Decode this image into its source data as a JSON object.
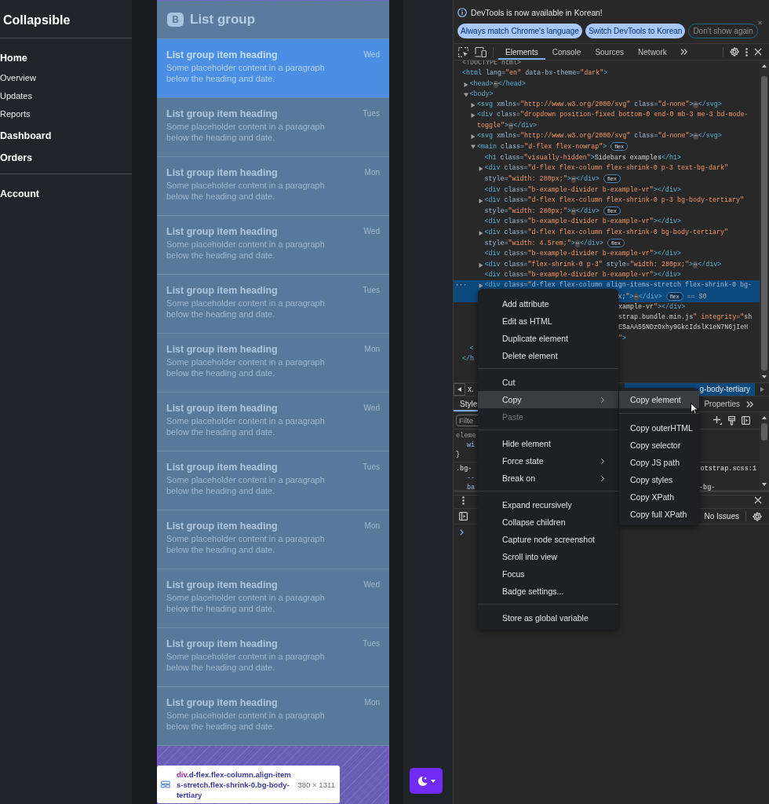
{
  "sidebar": {
    "title": "Collapsible",
    "sections": [
      {
        "label": "Home",
        "children": [
          {
            "label": "Overview"
          },
          {
            "label": "Updates"
          },
          {
            "label": "Reports"
          }
        ]
      },
      {
        "label": "Dashboard"
      },
      {
        "label": "Orders"
      }
    ],
    "footer": "Account"
  },
  "list_group": {
    "logo": "B",
    "title": "List group",
    "items": [
      {
        "heading": "List group item heading",
        "date": "Wed",
        "body": "Some placeholder content in a paragraph below the heading and date.",
        "selected": true
      },
      {
        "heading": "List group item heading",
        "date": "Tues",
        "body": "Some placeholder content in a paragraph below the heading and date.",
        "selected": false
      },
      {
        "heading": "List group item heading",
        "date": "Mon",
        "body": "Some placeholder content in a paragraph below the heading and date.",
        "selected": false
      },
      {
        "heading": "List group item heading",
        "date": "Wed",
        "body": "Some placeholder content in a paragraph below the heading and date.",
        "selected": false
      },
      {
        "heading": "List group item heading",
        "date": "Tues",
        "body": "Some placeholder content in a paragraph below the heading and date.",
        "selected": false
      },
      {
        "heading": "List group item heading",
        "date": "Mon",
        "body": "Some placeholder content in a paragraph below the heading and date.",
        "selected": false
      },
      {
        "heading": "List group item heading",
        "date": "Wed",
        "body": "Some placeholder content in a paragraph below the heading and date.",
        "selected": false
      },
      {
        "heading": "List group item heading",
        "date": "Tues",
        "body": "Some placeholder content in a paragraph below the heading and date.",
        "selected": false
      },
      {
        "heading": "List group item heading",
        "date": "Mon",
        "body": "Some placeholder content in a paragraph below the heading and date.",
        "selected": false
      },
      {
        "heading": "List group item heading",
        "date": "Wed",
        "body": "Some placeholder content in a paragraph below the heading and date.",
        "selected": false
      },
      {
        "heading": "List group item heading",
        "date": "Tues",
        "body": "Some placeholder content in a paragraph below the heading and date.",
        "selected": false
      },
      {
        "heading": "List group item heading",
        "date": "Mon",
        "body": "Some placeholder content in a paragraph below the heading and date.",
        "selected": false
      }
    ]
  },
  "inspect_tooltip": {
    "tag": "div",
    "classes": ".d-flex.flex-column.align-items-stretch.flex-shrink-0.bg-body-tertiary",
    "size": "380 × 1311"
  },
  "devtools": {
    "infobar": {
      "message": "DevTools is now available in Korean!",
      "buttons": [
        {
          "label": "Always match Chrome's language",
          "kind": "filled"
        },
        {
          "label": "Switch DevTools to Korean",
          "kind": "filled"
        },
        {
          "label": "Don't show again",
          "kind": "outlined"
        }
      ]
    },
    "tabs": [
      {
        "label": "Elements",
        "selected": true
      },
      {
        "label": "Console",
        "selected": false
      },
      {
        "label": "Sources",
        "selected": false
      },
      {
        "label": "Network",
        "selected": false
      }
    ],
    "tree": [
      {
        "text": "<!DOCTYPE html>",
        "kind": "doctype"
      },
      {
        "text": "<html lang=\"en\" data-bs-theme=\"dark\">",
        "kind": "element",
        "selected": false,
        "close": "</h",
        "children": [
          {
            "text": "<head>⋯</head>",
            "kind": "element",
            "selected": false,
            "expanded": false
          },
          {
            "text": "<body>",
            "kind": "element",
            "selected": false,
            "expanded": true,
            "close": "<",
            "children": [
              {
                "text": "<svg xmlns=\"http://www.w3.org/2000/svg\" class=\"d-none\">⋯</svg>",
                "kind": "element",
                "selected": false,
                "expanded": false
              },
              {
                "text": "<div class=\"dropdown position-fixed bottom-0 end-0 mb-3 me-3 bd-mode-toggle\">⋯</div>",
                "kind": "element",
                "selected": false,
                "expanded": false
              },
              {
                "text": "<svg xmlns=\"http://www.w3.org/2000/svg\" class=\"d-none\">⋯</svg>",
                "kind": "element",
                "selected": false,
                "expanded": false
              },
              {
                "text": "<main class=\"d-flex flex-nowrap\">",
                "kind": "element",
                "selected": false,
                "expanded": true,
                "badge": "flex",
                "children": [
                  {
                    "text": "<h1 class=\"visually-hidden\">Sidebars examples</h1>",
                    "kind": "element",
                    "selected": false
                  },
                  {
                    "text": "<div class=\"d-flex flex-column flex-shrink-0 p-3 text-bg-dark\" style=\"width: 280px;\">⋯</div>",
                    "kind": "element",
                    "selected": false,
                    "expanded": false,
                    "badge": "flex"
                  },
                  {
                    "text": "<div class=\"b-example-divider b-example-vr\"></div>",
                    "kind": "element",
                    "selected": false
                  },
                  {
                    "text": "<div class=\"d-flex flex-column flex-shrink-0 p-3 bg-body-tertiary\" style=\"width: 280px;\">⋯</div>",
                    "kind": "element",
                    "selected": false,
                    "expanded": false,
                    "badge": "flex"
                  },
                  {
                    "text": "<div class=\"b-example-divider b-example-vr\"></div>",
                    "kind": "element",
                    "selected": false
                  },
                  {
                    "text": "<div class=\"d-flex flex-column flex-shrink-0 bg-body-tertiary\" style=\"width: 4.5rem;\">⋯</div>",
                    "kind": "element",
                    "selected": false,
                    "expanded": false,
                    "badge": "flex"
                  },
                  {
                    "text": "<div class=\"b-example-divider b-example-vr\"></div>",
                    "kind": "element",
                    "selected": false
                  },
                  {
                    "text": "<div class=\"flex-shrink-0 p-3\" style=\"width: 280px;\">⋯</div>",
                    "kind": "element",
                    "selected": false,
                    "expanded": false
                  },
                  {
                    "text": "<div class=\"b-example-divider b-example-vr\"></div>",
                    "kind": "element",
                    "selected": false
                  },
                  {
                    "text": "<div class=\"d-flex flex-column align-items-stretch flex-shrink-0 bg-",
                    "continuation": "x;\">⋯</div>",
                    "gutter": "···",
                    "kind": "element",
                    "selected": true,
                    "expanded": false,
                    "badge": "flex",
                    "marker": "== $0"
                  },
                  {
                    "text": "xample-vr\"></div>",
                    "kind": "fragment"
                  },
                  {
                    "text": "strap.bundle.min.js\" integrity=\"sh",
                    "kind": "fragment"
                  },
                  {
                    "text": "ESaAA55NDzOxhy9GkcIdslK1eN7N6jIeH",
                    "kind": "fragment"
                  },
                  {
                    "text": "\">",
                    "kind": "fragment"
                  }
                ]
              }
            ]
          }
        ]
      }
    ],
    "breadcrumbs": [
      {
        "label": "x.",
        "selected": false
      },
      {
        "label": "g-body-tertiary",
        "selected": true
      }
    ],
    "styles_tabs": [
      {
        "label": "Style",
        "selected": true
      },
      {
        "label": "Properties",
        "selected": false
      }
    ],
    "styles_filter": {
      "placeholder": "Filte"
    },
    "rules": [
      {
        "selector": "eleme",
        "declarations": [
          {
            "text": "wi"
          }
        ],
        "close": "}"
      },
      {
        "selector": ".bg-",
        "source": "otstrap.scss:1",
        "declarations": [
          {
            "text": "--"
          },
          {
            "text": "ba",
            "value": "-bg-"
          }
        ]
      }
    ],
    "drawer": {
      "status": "No Issues"
    },
    "context_menu": {
      "groups": [
        [
          {
            "label": "Add attribute",
            "selected": false,
            "disabled": false,
            "submenu": false
          },
          {
            "label": "Edit as HTML",
            "selected": false,
            "disabled": false,
            "submenu": false
          },
          {
            "label": "Duplicate element",
            "selected": false,
            "disabled": false,
            "submenu": false
          },
          {
            "label": "Delete element",
            "selected": false,
            "disabled": false,
            "submenu": false
          }
        ],
        [
          {
            "label": "Cut",
            "selected": false,
            "disabled": false,
            "submenu": false
          },
          {
            "label": "Copy",
            "selected": true,
            "disabled": false,
            "submenu": true
          },
          {
            "label": "Paste",
            "selected": false,
            "disabled": true,
            "submenu": false
          }
        ],
        [
          {
            "label": "Hide element",
            "selected": false,
            "disabled": false,
            "submenu": false
          },
          {
            "label": "Force state",
            "selected": false,
            "disabled": false,
            "submenu": true
          },
          {
            "label": "Break on",
            "selected": false,
            "disabled": false,
            "submenu": true
          }
        ],
        [
          {
            "label": "Expand recursively",
            "selected": false,
            "disabled": false,
            "submenu": false
          },
          {
            "label": "Collapse children",
            "selected": false,
            "disabled": false,
            "submenu": false
          },
          {
            "label": "Capture node screenshot",
            "selected": false,
            "disabled": false,
            "submenu": false
          },
          {
            "label": "Scroll into view",
            "selected": false,
            "disabled": false,
            "submenu": false
          },
          {
            "label": "Focus",
            "selected": false,
            "disabled": false,
            "submenu": false
          },
          {
            "label": "Badge settings...",
            "selected": false,
            "disabled": false,
            "submenu": false
          }
        ],
        [
          {
            "label": "Store as global variable",
            "selected": false,
            "disabled": false,
            "submenu": false
          }
        ]
      ]
    },
    "copy_submenu": {
      "groups": [
        [
          {
            "label": "Copy element",
            "selected": true
          }
        ],
        [
          {
            "label": "Copy outerHTML",
            "selected": false
          },
          {
            "label": "Copy selector",
            "selected": false
          },
          {
            "label": "Copy JS path",
            "selected": false
          },
          {
            "label": "Copy styles",
            "selected": false
          },
          {
            "label": "Copy XPath",
            "selected": false
          },
          {
            "label": "Copy full XPath",
            "selected": false
          }
        ]
      ]
    }
  }
}
